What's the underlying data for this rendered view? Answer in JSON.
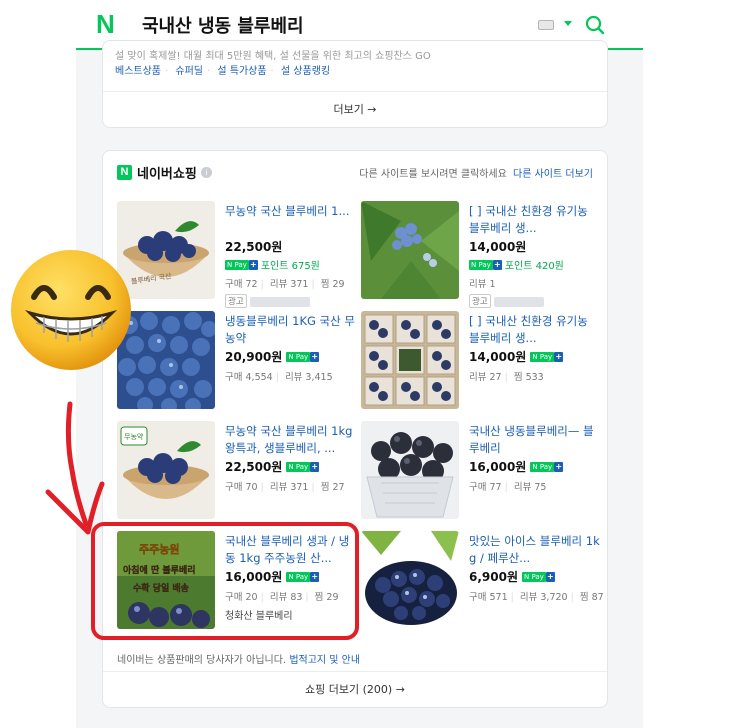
{
  "header": {
    "logo": "N",
    "query": "국내산 냉동 블루베리"
  },
  "top_card": {
    "promo_text": "설 맞이 혹제쌀! 대월 최대 5만원 혜택, 설 선물을 위한 최고의 쇼핑찬스 GO",
    "links": [
      "베스트상품",
      "슈퍼딜",
      "설 특가상품",
      "설 상품랭킹"
    ],
    "more_label": "더보기 →"
  },
  "shopping": {
    "badge": "N",
    "title": "네이버쇼핑",
    "hint": "다른 사이트를 보시려면 클릭하세요",
    "hint_link": "다른 사이트 더보기",
    "products": [
      {
        "title": "무농약 국산 블루베리 1...",
        "price": "22,500원",
        "npay": "N Pay",
        "point": "포인트 675원",
        "ad": "광고"
      },
      {
        "title": "[          ] 국내산 친환경 유기농 블루베리 생...",
        "price": "14,000원",
        "npay": "N Pay",
        "point": "포인트 420원",
        "ad": "광고"
      },
      {
        "title": "냉동블루베리 1KG 국산 무농약",
        "price": "20,900원",
        "npay": "N Pay",
        "meta": [
          "구매 4,554",
          "리뷰 3,415"
        ]
      },
      {
        "title": "[          ] 국내산 친환경 유기농 블루베리 생...",
        "price": "14,000원",
        "npay": "N Pay",
        "meta": [
          "리뷰 27",
          "찜 533"
        ]
      },
      {
        "title": "무농약 국산 블루베리 1kg 왕특과, 생블루베리, ...",
        "price": "22,500원",
        "npay": "N Pay",
        "meta": [
          "구매 70",
          "리뷰 371",
          "찜 27"
        ]
      },
      {
        "title": "국내산 냉동블루베리— 블루베리",
        "price": "16,000원",
        "npay": "N Pay",
        "meta": [
          "구매 77",
          "리뷰 75"
        ]
      },
      {
        "title": "국내산 블루베리 생과 / 냉동 1kg 주주농원 산...",
        "price": "16,000원",
        "npay": "N Pay",
        "meta": [
          "구매 20",
          "리뷰 83",
          "찜 29"
        ],
        "seller": "청화산 블루베리"
      },
      {
        "title": "맛있는 아이스 블루베리 1kg / 페루산...",
        "price": "6,900원",
        "npay": "N Pay",
        "meta": [
          "구매 571",
          "리뷰 3,720",
          "찜 87"
        ]
      }
    ],
    "p1_meta": [
      "구매 72",
      "리뷰 371",
      "찜 29"
    ],
    "p2_meta": [
      "리뷰 1"
    ],
    "disclaimer": "네이버는 상품판매의 당사자가 아닙니다.",
    "disclaimer_link": "법적고지 및 안내",
    "more_label": "쇼핑 더보기 (200) →"
  },
  "thumb_texts": {
    "bowl_sticker": "무농약",
    "farm_banner_1": "주주농원",
    "farm_banner_2": "아침에 딴 블루베리",
    "farm_banner_3": "수확 당일 배송"
  },
  "colors": {
    "naver_green": "#03c75a",
    "link_blue": "#1a5fb4",
    "highlight_red": "#e01f26"
  }
}
